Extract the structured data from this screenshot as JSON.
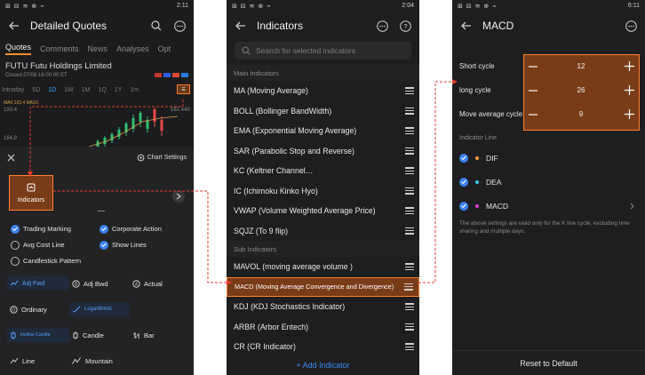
{
  "colors": {
    "accent": "#ff8030",
    "highlight_fill": "#7a3c18",
    "checkbox_blue": "#3b82f6",
    "link_blue": "#3b8df0",
    "connector_red": "#e53a2a"
  },
  "quotes_screen": {
    "status": {
      "left": "⊞ ⊟ ≋ ⊕ ⌁",
      "time": "2:11"
    },
    "title": "Detailed Quotes",
    "tabs": [
      "Quotes",
      "Comments",
      "News",
      "Analyses",
      "Opt"
    ],
    "stock_name": "FUTU  Futu Holdings Limited",
    "stock_status": "Closed   07/08 16:00:00 ET",
    "ranges": [
      "Intraday",
      "5D",
      "1D",
      "1W",
      "1M",
      "1Q",
      "1Y",
      "1m"
    ],
    "chart_labels": {
      "ma": "MA5 193.4  MA10:",
      "high": "193.4",
      "mid": "164.9",
      "right": "181.440"
    },
    "chart_settings": "Chart Settings",
    "indicators_label": "Indicators",
    "checks": [
      {
        "label": "Trading Marking",
        "on": true
      },
      {
        "label": "Corporate Action",
        "on": true
      },
      {
        "label": "Avg Cost Line",
        "on": false
      },
      {
        "label": "Show Lines",
        "on": true
      },
      {
        "label": "Candlestick Pattern",
        "on": false
      }
    ],
    "options": [
      {
        "label": "Adj Fwd",
        "icon": "adj-fwd-icon",
        "selected": true
      },
      {
        "label": "Adj Bwd",
        "icon": "adj-bwd-icon",
        "selected": false
      },
      {
        "label": "Actual",
        "icon": "actual-icon",
        "selected": false
      },
      {
        "label": "Ordinary",
        "icon": "ordinary-icon",
        "selected": false
      },
      {
        "label": "Logarithmic",
        "icon": "logarithmic-icon",
        "selected": true
      },
      {
        "label": "",
        "icon": "",
        "selected": false
      },
      {
        "label": "Hollow Candle",
        "icon": "hollow-candle-icon",
        "selected": true
      },
      {
        "label": "Candle",
        "icon": "candle-icon",
        "selected": false
      },
      {
        "label": "Bar",
        "icon": "bar-icon",
        "selected": false
      },
      {
        "label": "Line",
        "icon": "line-icon",
        "selected": false
      },
      {
        "label": "Mountain",
        "icon": "mountain-icon",
        "selected": false
      },
      {
        "label": "",
        "icon": "",
        "selected": false
      }
    ]
  },
  "indicators_screen": {
    "status": {
      "left": "⊞ ⊟ ≋ ⊕ ⌁",
      "time": "2:04"
    },
    "title": "Indicators",
    "search_placeholder": "Search for selected indicators",
    "main_section": "Main Indicators",
    "main_items": [
      "MA (Moving Average)",
      "BOLL (Bollinger BandWidth)",
      "EMA (Exponential Moving Average)",
      "SAR (Parabolic Stop and Reverse)",
      "KC (Keltner Channel…",
      "IC (Ichimoku Kinko Hyo)",
      "VWAP (Volume Weighted Average Price)",
      "SQJZ (To 9 flip)"
    ],
    "sub_section": "Sub Indicators",
    "sub_items": [
      "MAVOL (moving average volume )",
      "MACD (Moving Average Convergence and Divergence)",
      "KDJ (KDJ Stochastics Indicator)",
      "ARBR (Arbor Entech)",
      "CR (CR Indicator)"
    ],
    "add_label": "+  Add Indicator"
  },
  "macd_screen": {
    "status": {
      "left": "⊞ ⊟ ≋ ⊕ ⌁",
      "time": "6:11"
    },
    "title": "MACD",
    "params": [
      {
        "label": "Short cycle",
        "value": "12"
      },
      {
        "label": "long cycle",
        "value": "26"
      },
      {
        "label": "Move average cycle",
        "value": "9"
      }
    ],
    "line_section": "Indicator Line",
    "lines": [
      {
        "label": "DIF",
        "color": "#ff9a3c"
      },
      {
        "label": "DEA",
        "color": "#3bc7e0"
      },
      {
        "label": "MACD",
        "color": "#e040c8"
      }
    ],
    "note": "The above settings are valid only for the K line cycle, excluding time sharing and multiple days.",
    "reset_label": "Reset to Default"
  }
}
